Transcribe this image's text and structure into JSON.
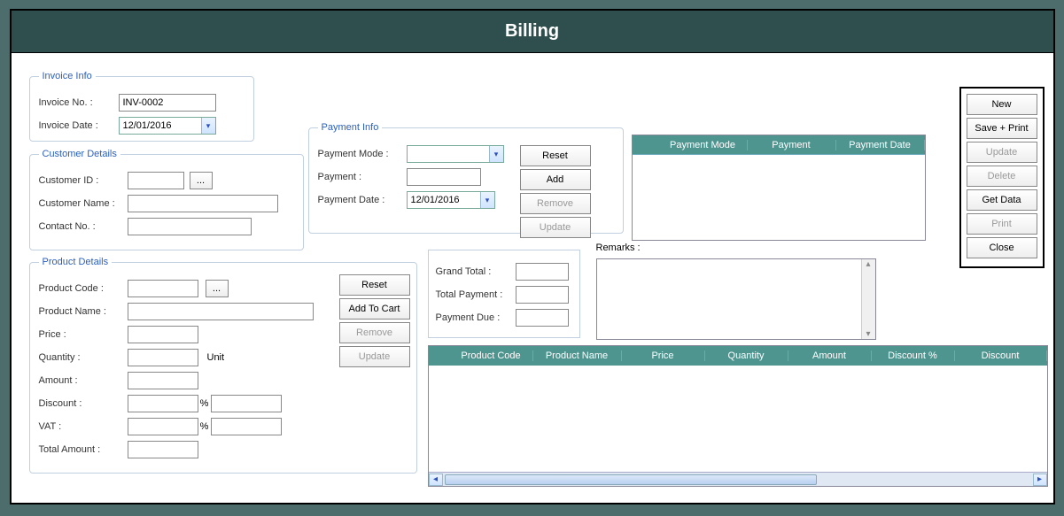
{
  "header": {
    "title": "Billing"
  },
  "invoice": {
    "legend": "Invoice Info",
    "no_label": "Invoice No. :",
    "no_value": "INV-0002",
    "date_label": "Invoice Date :",
    "date_value": "12/01/2016"
  },
  "customer": {
    "legend": "Customer Details",
    "id_label": "Customer ID :",
    "id_value": "",
    "browse": "...",
    "name_label": "Customer Name :",
    "name_value": "",
    "contact_label": "Contact No. :",
    "contact_value": ""
  },
  "product": {
    "legend": "Product Details",
    "code_label": "Product Code :",
    "code_value": "",
    "browse": "...",
    "name_label": "Product Name :",
    "name_value": "",
    "price_label": "Price :",
    "price_value": "",
    "qty_label": "Quantity :",
    "qty_value": "",
    "unit_label": "Unit",
    "amount_label": "Amount :",
    "amount_value": "",
    "discount_label": "Discount :",
    "discount_value": "",
    "discount_pct": "%",
    "discount_amt": "",
    "vat_label": "VAT :",
    "vat_value": "",
    "vat_pct": "%",
    "vat_amt": "",
    "total_label": "Total Amount :",
    "total_value": "",
    "buttons": {
      "reset": "Reset",
      "add": "Add To Cart",
      "remove": "Remove",
      "update": "Update"
    }
  },
  "payment": {
    "legend": "Payment Info",
    "mode_label": "Payment Mode :",
    "mode_value": "",
    "pay_label": "Payment :",
    "pay_value": "",
    "date_label": "Payment Date :",
    "date_value": "12/01/2016",
    "buttons": {
      "reset": "Reset",
      "add": "Add",
      "remove": "Remove",
      "update": "Update"
    }
  },
  "payment_table": {
    "headers": [
      "Payment Mode",
      "Payment",
      "Payment Date"
    ]
  },
  "totals": {
    "grand_label": "Grand Total :",
    "grand_value": "",
    "paid_label": "Total Payment :",
    "paid_value": "",
    "due_label": "Payment Due :",
    "due_value": ""
  },
  "remarks": {
    "label": "Remarks :",
    "value": ""
  },
  "product_grid": {
    "headers": [
      "Product Code",
      "Product Name",
      "Price",
      "Quantity",
      "Amount",
      "Discount %",
      "Discount"
    ]
  },
  "actions": {
    "new": "New",
    "save_print": "Save + Print",
    "update": "Update",
    "delete": "Delete",
    "get_data": "Get Data",
    "print": "Print",
    "close": "Close"
  }
}
